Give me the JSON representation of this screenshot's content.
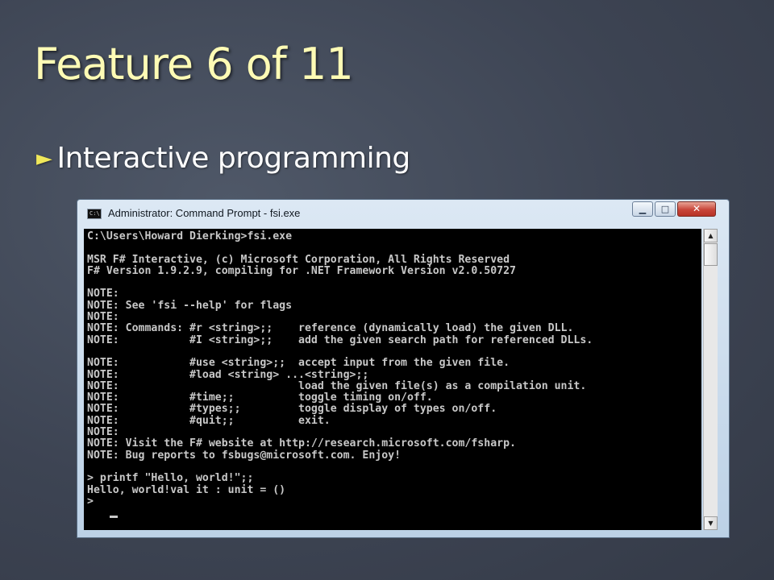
{
  "slide": {
    "title": "Feature 6 of 11",
    "bullet": "Interactive programming"
  },
  "window": {
    "title": "Administrator: Command Prompt - fsi.exe",
    "icon": "cmd-icon",
    "controls": {
      "minimize": "minimize-icon",
      "maximize": "maximize-icon",
      "close": "close-icon"
    }
  },
  "console": {
    "lines": [
      "C:\\Users\\Howard Dierking>fsi.exe",
      "",
      "MSR F# Interactive, (c) Microsoft Corporation, All Rights Reserved",
      "F# Version 1.9.2.9, compiling for .NET Framework Version v2.0.50727",
      "",
      "NOTE:",
      "NOTE: See 'fsi --help' for flags",
      "NOTE:",
      "NOTE: Commands: #r <string>;;    reference (dynamically load) the given DLL.",
      "NOTE:           #I <string>;;    add the given search path for referenced DLLs.",
      "",
      "NOTE:           #use <string>;;  accept input from the given file.",
      "NOTE:           #load <string> ...<string>;;",
      "NOTE:                            load the given file(s) as a compilation unit.",
      "NOTE:           #time;;          toggle timing on/off.",
      "NOTE:           #types;;         toggle display of types on/off.",
      "NOTE:           #quit;;          exit.",
      "NOTE:",
      "NOTE: Visit the F# website at http://research.microsoft.com/fsharp.",
      "NOTE: Bug reports to fsbugs@microsoft.com. Enjoy!",
      "",
      "> printf \"Hello, world!\";;",
      "Hello, world!val it : unit = ()",
      ">"
    ]
  },
  "colors": {
    "title": "#fefbb5",
    "bullet_marker": "#f0e85a",
    "console_bg": "#000000",
    "console_text": "#c8c8c8"
  }
}
